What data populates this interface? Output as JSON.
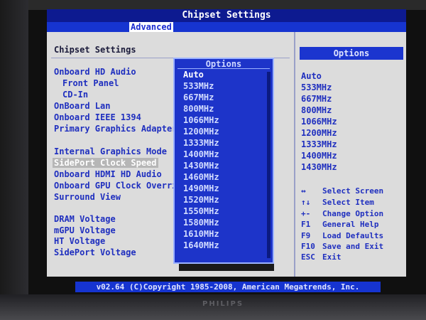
{
  "header": {
    "title": "Chipset Settings",
    "tab": "Advanced"
  },
  "left_panel": {
    "section_title": "Chipset Settings",
    "items": [
      {
        "label": "Onboard HD Audio"
      },
      {
        "label": "Front Panel"
      },
      {
        "label": "CD-In"
      },
      {
        "label": "OnBoard Lan"
      },
      {
        "label": "Onboard IEEE 1394"
      },
      {
        "label": "Primary Graphics Adapter"
      },
      {
        "label": "Internal Graphics Mode"
      },
      {
        "label": "SidePort Clock Speed"
      },
      {
        "label": "Onboard HDMI HD Audio"
      },
      {
        "label": "Onboard GPU Clock Override"
      },
      {
        "label": "Surround View"
      },
      {
        "label": "DRAM Voltage"
      },
      {
        "label": "mGPU Voltage"
      },
      {
        "label": "HT Voltage"
      },
      {
        "label": "SidePort Voltage"
      }
    ]
  },
  "popup": {
    "title": "Options",
    "options": [
      "Auto",
      "533MHz",
      "667MHz",
      "800MHz",
      "1066MHz",
      "1200MHz",
      "1333MHz",
      "1400MHz",
      "1430MHz",
      "1460MHz",
      "1490MHz",
      "1520MHz",
      "1550MHz",
      "1580MHz",
      "1610MHz",
      "1640MHz"
    ],
    "selected": "Auto"
  },
  "right_panel": {
    "title": "Options",
    "values": [
      "Auto",
      "533MHz",
      "667MHz",
      "800MHz",
      "1066MHz",
      "1200MHz",
      "1333MHz",
      "1400MHz",
      "1430MHz"
    ],
    "help": [
      {
        "key": "↔",
        "text": "Select Screen"
      },
      {
        "key": "↑↓",
        "text": "Select Item"
      },
      {
        "key": "+-",
        "text": "Change Option"
      },
      {
        "key": "F1",
        "text": "General Help"
      },
      {
        "key": "F9",
        "text": "Load Defaults"
      },
      {
        "key": "F10",
        "text": "Save and Exit"
      },
      {
        "key": "ESC",
        "text": "Exit"
      }
    ]
  },
  "footer": {
    "text": "v02.64 (C)Copyright 1985-2008, American Megatrends, Inc."
  },
  "monitor": {
    "brand": "PHILIPS"
  }
}
